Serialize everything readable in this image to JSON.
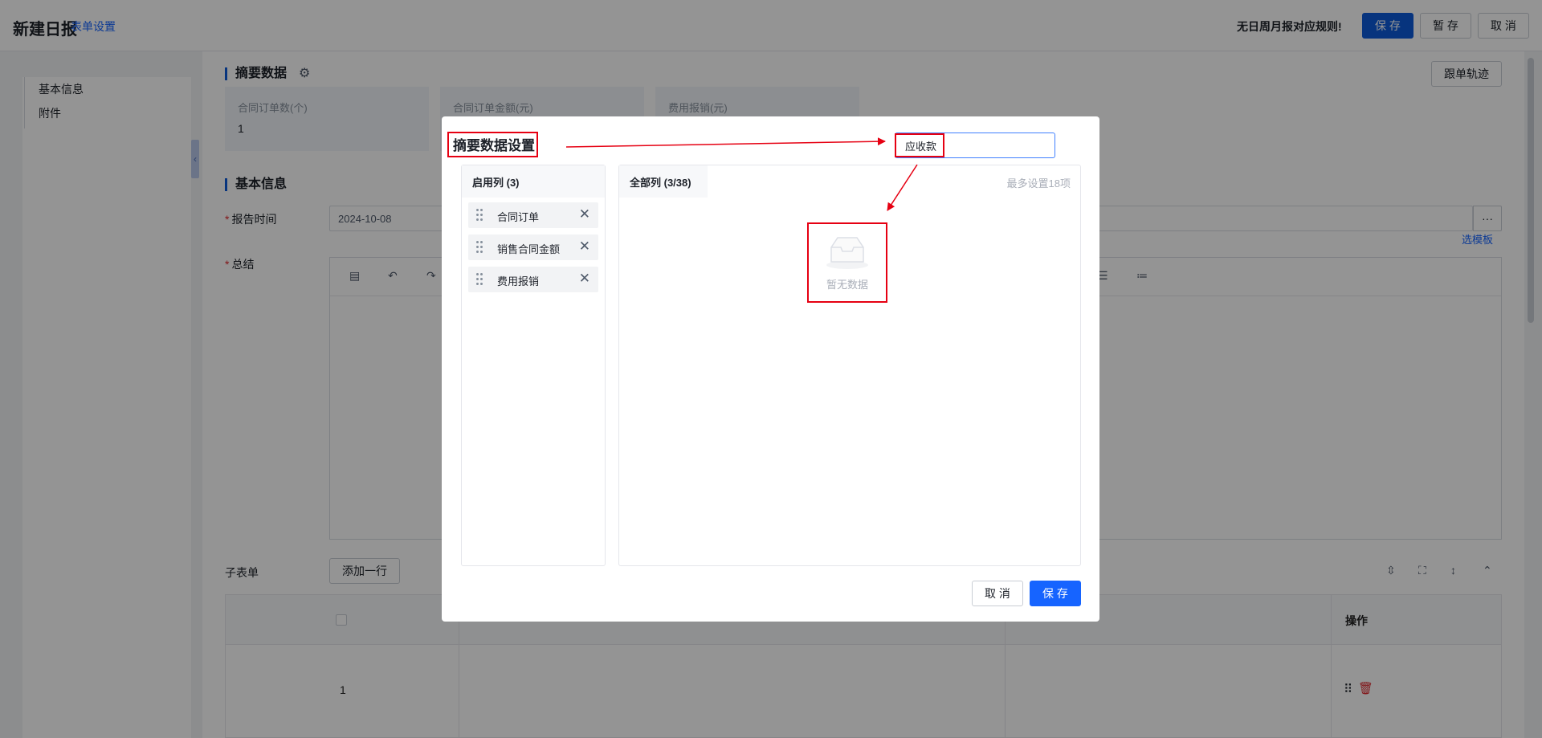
{
  "header": {
    "title": "新建日报",
    "form_settings": "表单设置",
    "warning": "无日周月报对应规则!",
    "save": "保 存",
    "draft": "暂 存",
    "cancel": "取 消"
  },
  "sidebar": {
    "items": [
      {
        "label": "基本信息"
      },
      {
        "label": "附件"
      }
    ]
  },
  "summary": {
    "title": "摘要数据",
    "track_button": "跟单轨迹",
    "cards": [
      {
        "label": "合同订单数(个)",
        "value": "1"
      },
      {
        "label": "合同订单金额(元)",
        "value": ""
      },
      {
        "label": "费用报销(元)",
        "value": ""
      }
    ]
  },
  "basic_info": {
    "title": "基本信息",
    "report_time_label": "报告时间",
    "report_time_value": "2024-10-08",
    "more": "···",
    "choose_template": "选模板",
    "summary_label": "总结"
  },
  "subform": {
    "label": "子表单",
    "add_row": "添加一行",
    "col_action": "操作",
    "row_index": "1"
  },
  "modal": {
    "title": "摘要数据设置",
    "search_value": "应收款",
    "enabled_header": "启用列 (3)",
    "all_header": "全部列 (3/38)",
    "limit_text": "最多设置18项",
    "enabled_columns": [
      {
        "label": "合同订单"
      },
      {
        "label": "销售合同金额"
      },
      {
        "label": "费用报销"
      }
    ],
    "empty_text": "暂无数据",
    "cancel": "取 消",
    "save": "保 存"
  },
  "colors": {
    "primary": "#0d5bd9",
    "modal_primary": "#1664ff",
    "annotation_red": "#e60012",
    "danger": "#e0282e"
  }
}
